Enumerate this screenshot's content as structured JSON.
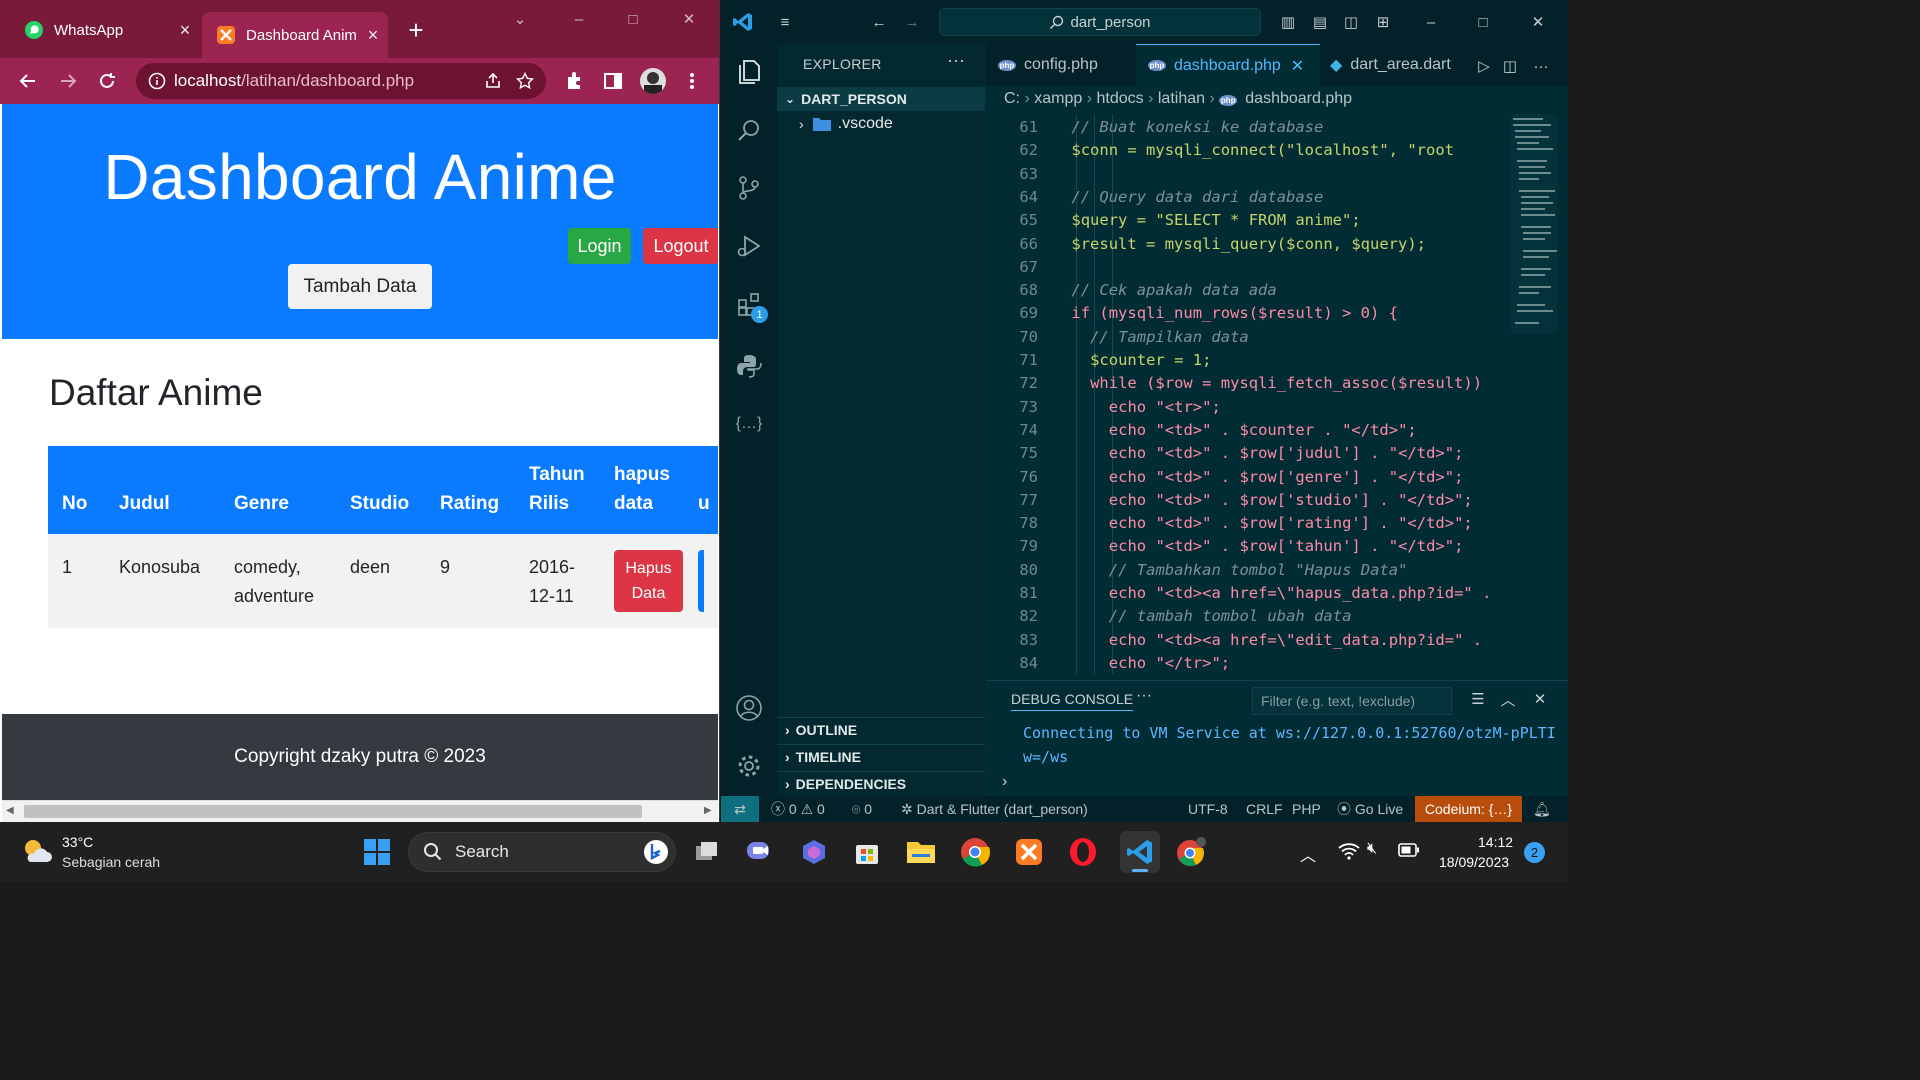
{
  "browser": {
    "tabs": [
      {
        "title": "WhatsApp"
      },
      {
        "title": "Dashboard Anim"
      }
    ],
    "url_host": "localhost",
    "url_path": "/latihan/dashboard.php"
  },
  "page": {
    "title": "Dashboard Anime",
    "login_label": "Login",
    "logout_label": "Logout",
    "add_label": "Tambah Data",
    "list_title": "Daftar Anime",
    "columns": [
      "No",
      "Judul",
      "Genre",
      "Studio",
      "Rating",
      "Tahun Rilis",
      "hapus data",
      "u"
    ],
    "rows": [
      {
        "no": "1",
        "judul": "Konosuba",
        "genre": "comedy, adventure",
        "studio": "deen",
        "rating": "9",
        "tahun": "2016-12-11",
        "hapus": "Hapus Data"
      }
    ],
    "footer": "Copyright dzaky putra © 2023"
  },
  "vscode": {
    "search": "dart_person",
    "explorer_title": "EXPLORER",
    "root_folder": "DART_PERSON",
    "folder_item": ".vscode",
    "sections": [
      "OUTLINE",
      "TIMELINE",
      "DEPENDENCIES"
    ],
    "tabs": [
      "config.php",
      "dashboard.php",
      "dart_area.dart"
    ],
    "breadcrumb": [
      "C:",
      "xampp",
      "htdocs",
      "latihan",
      "dashboard.php"
    ],
    "extensions_badge": "1",
    "code_lines": [
      {
        "n": "61",
        "text": "// Buat koneksi ke database"
      },
      {
        "n": "62",
        "text": "$conn = mysqli_connect(\"localhost\", \"root"
      },
      {
        "n": "63",
        "text": ""
      },
      {
        "n": "64",
        "text": "// Query data dari database"
      },
      {
        "n": "65",
        "text": "$query = \"SELECT * FROM anime\";"
      },
      {
        "n": "66",
        "text": "$result = mysqli_query($conn, $query);"
      },
      {
        "n": "67",
        "text": ""
      },
      {
        "n": "68",
        "text": "// Cek apakah data ada"
      },
      {
        "n": "69",
        "text": "if (mysqli_num_rows($result) > 0) {"
      },
      {
        "n": "70",
        "text": "// Tampilkan data"
      },
      {
        "n": "71",
        "text": "$counter = 1;"
      },
      {
        "n": "72",
        "text": "while ($row = mysqli_fetch_assoc($result))"
      },
      {
        "n": "73",
        "text": "echo \"<tr>\";"
      },
      {
        "n": "74",
        "text": "echo \"<td>\" . $counter . \"</td>\";"
      },
      {
        "n": "75",
        "text": "echo \"<td>\" . $row['judul'] . \"</td>\";"
      },
      {
        "n": "76",
        "text": "echo \"<td>\" . $row['genre'] . \"</td>\";"
      },
      {
        "n": "77",
        "text": "echo \"<td>\" . $row['studio'] . \"</td>\";"
      },
      {
        "n": "78",
        "text": "echo \"<td>\" . $row['rating'] . \"</td>\";"
      },
      {
        "n": "79",
        "text": "echo \"<td>\" . $row['tahun'] . \"</td>\";"
      },
      {
        "n": "80",
        "text": "// Tambahkan tombol \"Hapus Data\""
      },
      {
        "n": "81",
        "text": "echo \"<td><a href=\\\"hapus_data.php?id=\" ."
      },
      {
        "n": "82",
        "text": "// tambah tombol ubah data"
      },
      {
        "n": "83",
        "text": "echo \"<td><a href=\\\"edit_data.php?id=\" ."
      },
      {
        "n": "84",
        "text": "echo \"</tr>\";"
      }
    ],
    "panel_title": "DEBUG CONSOLE",
    "panel_filter_placeholder": "Filter (e.g. text, !exclude)",
    "console_output": "Connecting to VM Service at ws://127.0.0.1:52760/otzM-pPLTIw=/ws",
    "status": {
      "errors": "0",
      "warnings": "0",
      "ports": "0",
      "debug_target": "Dart & Flutter (dart_person)",
      "encoding": "UTF-8",
      "eol": "CRLF",
      "language": "PHP",
      "golive": "Go Live",
      "codeium": "Codeium: {…}"
    }
  },
  "taskbar": {
    "weather_temp": "33°C",
    "weather_desc": "Sebagian cerah",
    "search_label": "Search",
    "time": "14:12",
    "date": "18/09/2023",
    "notification_count": "2"
  }
}
